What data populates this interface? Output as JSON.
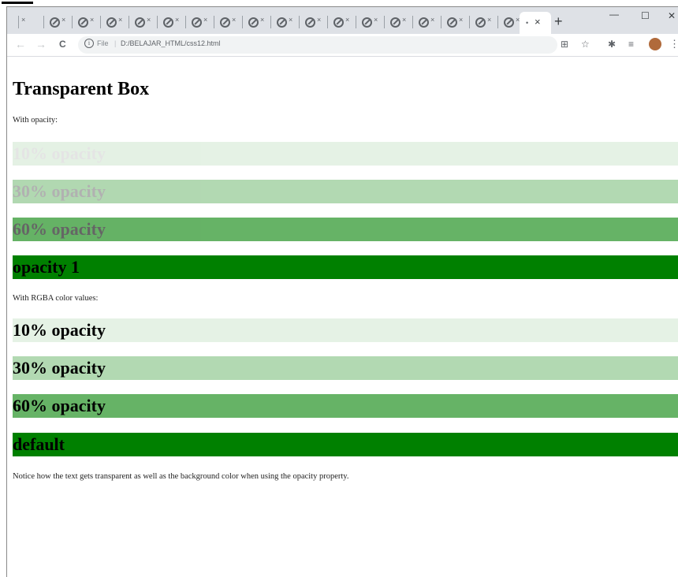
{
  "browser": {
    "tab_close_glyph": "×",
    "active_tab_glyph": "• ×",
    "new_tab_glyph": "+",
    "window_controls": [
      "—",
      "☐",
      "✕"
    ],
    "nav": {
      "back": "←",
      "forward": "→",
      "reload": "C"
    },
    "address": {
      "info_glyph": "i",
      "scheme": "File",
      "separator": "|",
      "url": "D:/BELAJAR_HTML/css12.html"
    },
    "toolbar_icons": [
      "translate-icon",
      "star-icon",
      "extension-icon",
      "media-icon",
      "avatar",
      "more-icon"
    ]
  },
  "page": {
    "title": "Transparent Box",
    "opacity_intro": "With opacity:",
    "opacity_boxes": [
      {
        "label": "10% opacity",
        "opacity": 0.1
      },
      {
        "label": "30% opacity",
        "opacity": 0.3
      },
      {
        "label": "60% opacity",
        "opacity": 0.6
      },
      {
        "label": "opacity 1",
        "opacity": 1
      }
    ],
    "rgba_intro": "With RGBA color values:",
    "rgba_boxes": [
      {
        "label": "10% opacity",
        "alpha": 0.1
      },
      {
        "label": "30% opacity",
        "alpha": 0.3
      },
      {
        "label": "60% opacity",
        "alpha": 0.6
      },
      {
        "label": "default",
        "alpha": 1
      }
    ],
    "note": "Notice how the text gets transparent as well as the background color when using the opacity property.",
    "colors": {
      "box_green": "#008000",
      "text": "#000000"
    }
  }
}
